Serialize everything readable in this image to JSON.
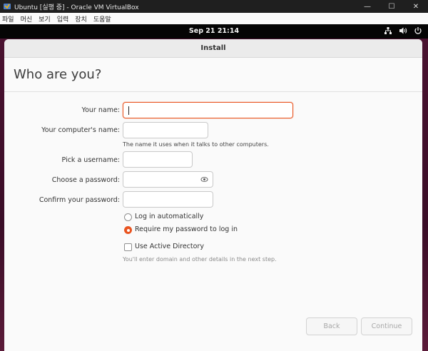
{
  "host": {
    "window_title": "Ubuntu [실행 중] - Oracle VM VirtualBox",
    "menu": [
      "파일",
      "머신",
      "보기",
      "입력",
      "장치",
      "도움말"
    ],
    "controls": {
      "minimize": "—",
      "maximize": "☐",
      "close": "✕"
    }
  },
  "panel": {
    "clock": "Sep 21  21:14",
    "icons": [
      "network-icon",
      "volume-icon",
      "power-icon"
    ]
  },
  "installer": {
    "window_title": "Install",
    "page_title": "Who are you?",
    "fields": {
      "your_name": {
        "label": "Your name:",
        "value": ""
      },
      "computer_name": {
        "label": "Your computer's name:",
        "value": "",
        "hint": "The name it uses when it talks to other computers."
      },
      "username": {
        "label": "Pick a username:",
        "value": ""
      },
      "password": {
        "label": "Choose a password:",
        "value": ""
      },
      "confirm_password": {
        "label": "Confirm your password:",
        "value": ""
      }
    },
    "login_options": {
      "auto": {
        "label": "Log in automatically",
        "selected": false
      },
      "require_password": {
        "label": "Require my password to log in",
        "selected": true
      }
    },
    "active_directory": {
      "label": "Use Active Directory",
      "checked": false,
      "hint": "You'll enter domain and other details in the next step."
    },
    "buttons": {
      "back": "Back",
      "continue": "Continue"
    }
  },
  "colors": {
    "accent": "#e95420",
    "panel": "#050505",
    "desktop": "#4a1230"
  }
}
